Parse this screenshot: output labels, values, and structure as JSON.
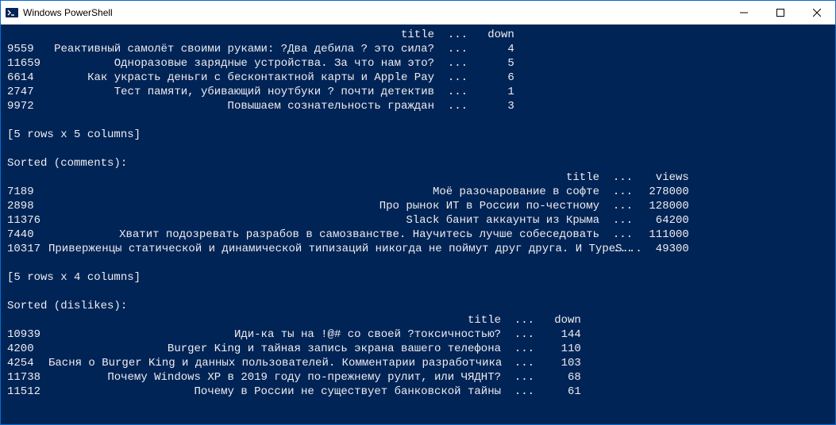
{
  "window": {
    "title": "Windows PowerShell"
  },
  "table1": {
    "header": {
      "c1": "title",
      "c2": "...",
      "c3": "down"
    },
    "title_width": 486,
    "rows": [
      {
        "id": "9559",
        "title": "Реактивный самолёт своими руками: ?Два дебила ? это сила?",
        "ell": "...",
        "down": "4"
      },
      {
        "id": "11659",
        "title": "Одноразовые зарядные устройства. За что нам это?",
        "ell": "...",
        "down": "5"
      },
      {
        "id": "6614",
        "title": "Как украсть деньги с бесконтактной карты и Apple Pay",
        "ell": "...",
        "down": "6"
      },
      {
        "id": "2747",
        "title": "Тест памяти, убивающий ноутбуки ? почти детектив",
        "ell": "...",
        "down": "1"
      },
      {
        "id": "9972",
        "title": "Повышаем сознательность граждан",
        "ell": "...",
        "down": "3"
      }
    ],
    "footer": "[5 rows x 5 columns]"
  },
  "section2": {
    "label": "Sorted (comments):"
  },
  "table2": {
    "header": {
      "c1": "title",
      "c2": "...",
      "c3": "views"
    },
    "title_width": 694,
    "rows": [
      {
        "id": "7189",
        "title": "Моё разочарование в софте",
        "ell": "...",
        "views": "278000"
      },
      {
        "id": "2898",
        "title": "Про рынок ИТ в России по-честному",
        "ell": "...",
        "views": "128000"
      },
      {
        "id": "11376",
        "title": "Slack банит аккаунты из Крыма",
        "ell": "...",
        "views": "64200"
      },
      {
        "id": "7440",
        "title": "Хватит подозревать разрабов в самозванстве. Научитесь лучше собеседовать",
        "ell": "...",
        "views": "111000"
      },
      {
        "id": "10317",
        "title": "Приверженцы статической и динамической типизаций никогда не поймут друг друга. И TypeS...",
        "ell": "...",
        "views": "49300"
      }
    ],
    "footer": "[5 rows x 4 columns]"
  },
  "section3": {
    "label": "Sorted (dislikes):"
  },
  "table3": {
    "header": {
      "c1": "title",
      "c2": "...",
      "c3": "down"
    },
    "title_width": 570,
    "rows": [
      {
        "id": "10939",
        "title": "Иди-ка ты на !@# со своей ?токсичностью?",
        "ell": "...",
        "down": "144"
      },
      {
        "id": "4200",
        "title": "Burger King и тайная запись экрана вашего телефона",
        "ell": "...",
        "down": "110"
      },
      {
        "id": "4254",
        "title": "Басня о Burger King и данных пользователей. Комментарии разработчика",
        "ell": "...",
        "down": "103"
      },
      {
        "id": "11738",
        "title": "Почему Windows XP в 2019 году по-прежнему рулит, или ЧЯДНТ?",
        "ell": "...",
        "down": "68"
      },
      {
        "id": "11512",
        "title": "Почему в России не существует банковской тайны",
        "ell": "...",
        "down": "61"
      }
    ]
  }
}
